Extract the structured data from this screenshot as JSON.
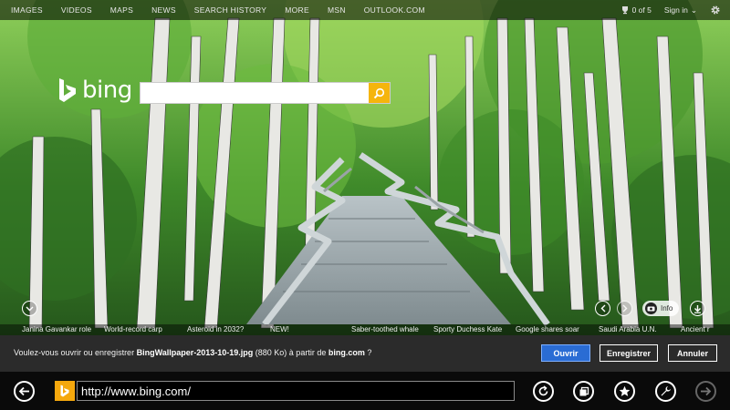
{
  "topbar": {
    "nav": [
      "IMAGES",
      "VIDEOS",
      "MAPS",
      "NEWS",
      "SEARCH HISTORY",
      "MORE",
      "MSN",
      "OUTLOOK.COM"
    ],
    "rewards": "0 of 5",
    "signin": "Sign in",
    "caret": "⌄"
  },
  "logo": {
    "word": "bing"
  },
  "search": {
    "value": "",
    "placeholder": ""
  },
  "hero": {
    "info_label": "Info"
  },
  "news": [
    "Janina Gavankar role",
    "World-record carp",
    "Asteroid in 2032?",
    "NEW!",
    "Saber-toothed whale",
    "Sporty Duchess Kate",
    "Google shares soar",
    "Saudi Arabia U.N.",
    "Ancient r"
  ],
  "download": {
    "prefix": "Voulez-vous ouvrir ou enregistrer ",
    "filename": "BingWallpaper-2013-10-19.jpg",
    "size": " (880 Ko) à partir de ",
    "site": "bing.com",
    "suffix": " ?",
    "open": "Ouvrir",
    "save": "Enregistrer",
    "cancel": "Annuler"
  },
  "address": {
    "url": "http://www.bing.com/"
  },
  "icons": {
    "back": "back-arrow-icon",
    "refresh": "refresh-icon",
    "tabs": "tabs-icon",
    "favorites": "star-icon",
    "tools": "wrench-icon",
    "forward": "forward-arrow-icon"
  },
  "colors": {
    "accent_yellow": "#f5b50d",
    "open_button": "#2a6cd4",
    "download_bar": "#2b2b2b"
  }
}
